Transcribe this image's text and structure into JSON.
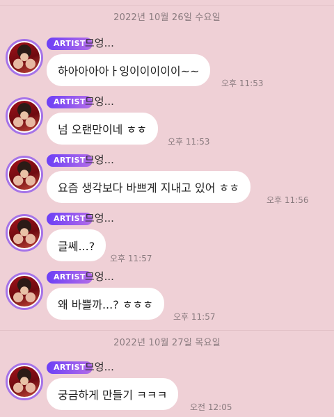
{
  "date_separators": [
    "2022년 10월 26일 수요일",
    "2022년 10월 27일 목요일"
  ],
  "messages": [
    {
      "badge": "ARTIST",
      "sender": "므엉...",
      "text": "하아아아아ㅏ잉이이이이이~~",
      "time": "오후 11:53"
    },
    {
      "badge": "ARTIST",
      "sender": "므엉...",
      "text": "넘 오랜만이네 ㅎㅎ",
      "time": "오후 11:53"
    },
    {
      "badge": "ARTIST",
      "sender": "므엉...",
      "text": "요즘 생각보다 바쁘게 지내고 있어 ㅎㅎ",
      "time": "오후 11:56"
    },
    {
      "badge": "ARTIST",
      "sender": "므엉...",
      "text": "글쎄...?",
      "time": "오후 11:57"
    },
    {
      "badge": "ARTIST",
      "sender": "므엉...",
      "text": "왜 바쁠까...? ㅎㅎㅎ",
      "time": "오후 11:57"
    },
    {
      "badge": "ARTIST",
      "sender": "므엉...",
      "text": "궁금하게 만들기 ㅋㅋㅋ",
      "time": "오전 12:05"
    }
  ],
  "colors": {
    "background": "#efd0d6",
    "bubble": "#ffffff",
    "badge_start": "#6c3ff6",
    "badge_end": "#b36de8",
    "avatar_ring": "#a573e8",
    "meta_text": "#8a7b7f"
  },
  "icons": {
    "avatar": "artist-profile-photo"
  }
}
